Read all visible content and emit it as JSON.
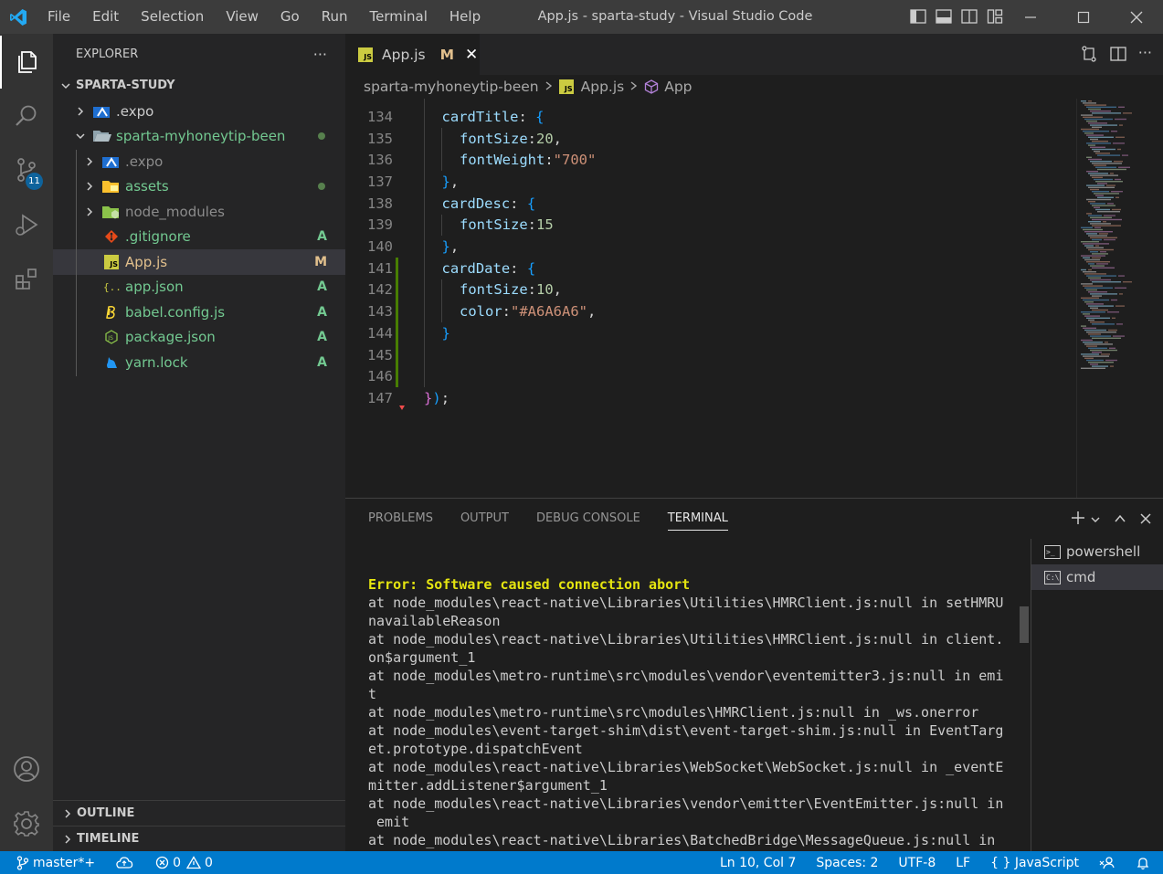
{
  "titlebar": {
    "menu": [
      "File",
      "Edit",
      "Selection",
      "View",
      "Go",
      "Run",
      "Terminal",
      "Help"
    ],
    "title": "App.js - sparta-study - Visual Studio Code"
  },
  "activity": {
    "scm_badge": "11"
  },
  "sidebar": {
    "header": "EXPLORER",
    "more": "···",
    "workspace": "SPARTA-STUDY",
    "tree": [
      {
        "label": ".expo",
        "color": "#cccccc",
        "status": "",
        "dot": false
      },
      {
        "label": "sparta-myhoneytip-been",
        "color": "#73c991",
        "status": "",
        "dot": true
      },
      {
        "label": ".expo",
        "color": "#8c8c8c",
        "status": "",
        "dot": false
      },
      {
        "label": "assets",
        "color": "#73c991",
        "status": "",
        "dot": true
      },
      {
        "label": "node_modules",
        "color": "#8c8c8c",
        "status": "",
        "dot": false
      },
      {
        "label": ".gitignore",
        "color": "#73c991",
        "status": "A",
        "dot": false
      },
      {
        "label": "App.js",
        "color": "#e2c08d",
        "status": "M",
        "dot": false
      },
      {
        "label": "app.json",
        "color": "#73c991",
        "status": "A",
        "dot": false
      },
      {
        "label": "babel.config.js",
        "color": "#73c991",
        "status": "A",
        "dot": false
      },
      {
        "label": "package.json",
        "color": "#73c991",
        "status": "A",
        "dot": false
      },
      {
        "label": "yarn.lock",
        "color": "#73c991",
        "status": "A",
        "dot": false
      }
    ],
    "outline": "OUTLINE",
    "timeline": "TIMELINE"
  },
  "editor": {
    "tab_label": "App.js",
    "tab_status": "M",
    "tab_close": "✕",
    "js_badge": "JS",
    "breadcrumb": [
      "sparta-myhoneytip-been",
      "App.js",
      "App"
    ],
    "lines": [
      {
        "n": "134",
        "indent": 1,
        "tokens": [
          [
            "cardTitle",
            "prop"
          ],
          [
            ": ",
            "punc"
          ],
          [
            "{",
            "br1"
          ]
        ]
      },
      {
        "n": "135",
        "indent": 2,
        "tokens": [
          [
            "fontSize",
            "prop"
          ],
          [
            ":",
            "punc"
          ],
          [
            "20",
            "num"
          ],
          [
            ",",
            "punc"
          ]
        ]
      },
      {
        "n": "136",
        "indent": 2,
        "tokens": [
          [
            "fontWeight",
            "prop"
          ],
          [
            ":",
            "punc"
          ],
          [
            "\"700\"",
            "str"
          ]
        ]
      },
      {
        "n": "137",
        "indent": 1,
        "tokens": [
          [
            "}",
            "br1"
          ],
          [
            ",",
            "punc"
          ]
        ]
      },
      {
        "n": "138",
        "indent": 1,
        "tokens": [
          [
            "cardDesc",
            "prop"
          ],
          [
            ": ",
            "punc"
          ],
          [
            "{",
            "br1"
          ]
        ]
      },
      {
        "n": "139",
        "indent": 2,
        "tokens": [
          [
            "fontSize",
            "prop"
          ],
          [
            ":",
            "punc"
          ],
          [
            "15",
            "num"
          ]
        ]
      },
      {
        "n": "140",
        "indent": 1,
        "tokens": [
          [
            "}",
            "br1"
          ],
          [
            ",",
            "punc"
          ]
        ]
      },
      {
        "n": "141",
        "indent": 1,
        "tokens": [
          [
            "cardDate",
            "prop"
          ],
          [
            ": ",
            "punc"
          ],
          [
            "{",
            "br1"
          ]
        ]
      },
      {
        "n": "142",
        "indent": 2,
        "tokens": [
          [
            "fontSize",
            "prop"
          ],
          [
            ":",
            "punc"
          ],
          [
            "10",
            "num"
          ],
          [
            ",",
            "punc"
          ]
        ]
      },
      {
        "n": "143",
        "indent": 2,
        "tokens": [
          [
            "color",
            "prop"
          ],
          [
            ":",
            "punc"
          ],
          [
            "\"#A6A6A6\"",
            "str"
          ],
          [
            ",",
            "punc"
          ]
        ]
      },
      {
        "n": "144",
        "indent": 1,
        "tokens": [
          [
            "}",
            "br1"
          ]
        ]
      },
      {
        "n": "145",
        "indent": 0,
        "tokens": []
      },
      {
        "n": "146",
        "indent": 0,
        "tokens": []
      },
      {
        "n": "147",
        "indent": 0,
        "tokens": [
          [
            "}",
            "br2"
          ],
          [
            ")",
            "br1"
          ],
          [
            ";",
            "punc"
          ]
        ]
      }
    ]
  },
  "panel": {
    "tabs": [
      "PROBLEMS",
      "OUTPUT",
      "DEBUG CONSOLE",
      "TERMINAL"
    ],
    "active_tab": "TERMINAL",
    "terminal_lines": [
      {
        "text": "Error: Software caused connection abort",
        "error": true
      },
      {
        "text": "at node_modules\\react-native\\Libraries\\Utilities\\HMRClient.js:null in setHMRU",
        "error": false
      },
      {
        "text": "navailableReason",
        "error": false
      },
      {
        "text": "at node_modules\\react-native\\Libraries\\Utilities\\HMRClient.js:null in client.",
        "error": false
      },
      {
        "text": "on$argument_1",
        "error": false
      },
      {
        "text": "at node_modules\\metro-runtime\\src\\modules\\vendor\\eventemitter3.js:null in emi",
        "error": false
      },
      {
        "text": "t",
        "error": false
      },
      {
        "text": "at node_modules\\metro-runtime\\src\\modules\\HMRClient.js:null in _ws.onerror",
        "error": false
      },
      {
        "text": "at node_modules\\event-target-shim\\dist\\event-target-shim.js:null in EventTarg",
        "error": false
      },
      {
        "text": "et.prototype.dispatchEvent",
        "error": false
      },
      {
        "text": "at node_modules\\react-native\\Libraries\\WebSocket\\WebSocket.js:null in _eventE",
        "error": false
      },
      {
        "text": "mitter.addListener$argument_1",
        "error": false
      },
      {
        "text": "at node_modules\\react-native\\Libraries\\vendor\\emitter\\EventEmitter.js:null in",
        "error": false
      },
      {
        "text": " emit",
        "error": false
      },
      {
        "text": "at node_modules\\react-native\\Libraries\\BatchedBridge\\MessageQueue.js:null in",
        "error": false
      }
    ],
    "terminals": [
      "powershell",
      "cmd"
    ],
    "selected_terminal": "cmd",
    "powershell_glyph": ">_",
    "cmd_glyph": "C:\\"
  },
  "statusbar": {
    "branch": "master*+",
    "errors": "0",
    "warnings": "0",
    "position": "Ln 10, Col 7",
    "spaces": "Spaces: 2",
    "encoding": "UTF-8",
    "eol": "LF",
    "language_glyph": "{ }",
    "language": "JavaScript"
  },
  "colors": {
    "accent": "#007acc",
    "modified": "#e2c08d",
    "added": "#73c991"
  }
}
